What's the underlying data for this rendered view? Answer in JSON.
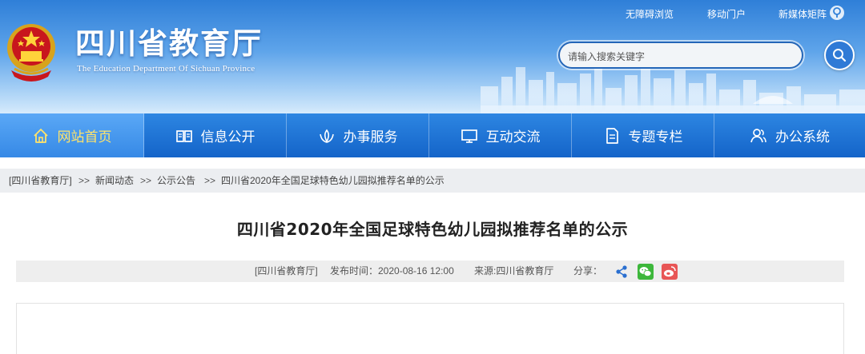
{
  "header": {
    "title": "四川省教育厅",
    "subtitle": "The Education Department Of Sichuan Province",
    "top_links": [
      "无障碍浏览",
      "移动门户",
      "新媒体矩阵"
    ],
    "search": {
      "placeholder": "请输入搜索关键字",
      "value": ""
    }
  },
  "nav": {
    "items": [
      {
        "label": "网站首页",
        "icon": "home-icon",
        "active": true
      },
      {
        "label": "信息公开",
        "icon": "book-icon",
        "active": false
      },
      {
        "label": "办事服务",
        "icon": "service-icon",
        "active": false
      },
      {
        "label": "互动交流",
        "icon": "monitor-icon",
        "active": false
      },
      {
        "label": "专题专栏",
        "icon": "document-icon",
        "active": false
      },
      {
        "label": "办公系统",
        "icon": "users-icon",
        "active": false
      }
    ]
  },
  "breadcrumb": {
    "items": [
      "[四川省教育厅]",
      "新闻动态",
      "公示公告",
      "四川省2020年全国足球特色幼儿园拟推荐名单的公示"
    ],
    "separator": ">>"
  },
  "article": {
    "title": "四川省2020年全国足球特色幼儿园拟推荐名单的公示",
    "meta": {
      "site": "[四川省教育厅]",
      "published": "发布时间：2020-08-16 12:00",
      "source": "来源:四川省教育厅",
      "share_label": "分享："
    }
  },
  "colors": {
    "nav_bg": "#1464c9",
    "nav_active": "#3689e6",
    "nav_active_text": "#ffe36a",
    "wechat": "#3db73b",
    "weibo": "#e85656",
    "share": "#2a6fd0"
  }
}
